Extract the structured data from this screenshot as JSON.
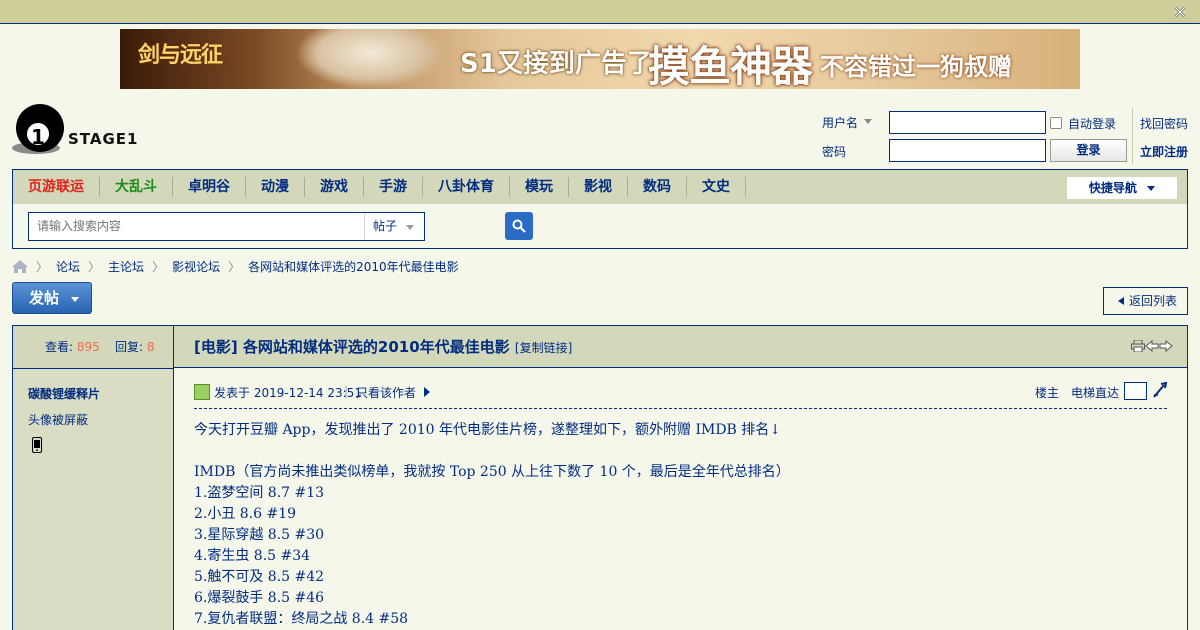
{
  "topbar": {
    "close_icon": "close-icon"
  },
  "banner": {
    "game_logo": "剑与远征",
    "ad_line_a": "S1又接到广告了",
    "ad_line_b": "摸鱼神器",
    "ad_line_c": "不容错过一狗叔赠"
  },
  "logo": {
    "number": "1",
    "text": "STAGE1"
  },
  "login": {
    "username_label": "用户名",
    "password_label": "密码",
    "auto_login": "自动登录",
    "login_button": "登录",
    "find_password": "找回密码",
    "register": "立即注册"
  },
  "nav": {
    "items": [
      {
        "label": "页游联运",
        "color": "#e0241a"
      },
      {
        "label": "大乱斗",
        "color": "#1c8c1c"
      },
      {
        "label": "卓明谷"
      },
      {
        "label": "动漫"
      },
      {
        "label": "游戏"
      },
      {
        "label": "手游"
      },
      {
        "label": "八卦体育"
      },
      {
        "label": "模玩"
      },
      {
        "label": "影视"
      },
      {
        "label": "数码"
      },
      {
        "label": "文史"
      }
    ],
    "quick_nav": "快捷导航",
    "search_placeholder": "请输入搜索内容",
    "search_type": "帖子"
  },
  "breadcrumb": [
    "论坛",
    "主论坛",
    "影视论坛",
    "各网站和媒体评选的2010年代最佳电影"
  ],
  "post_button": "发帖",
  "back_button": "返回列表",
  "thread": {
    "views_label": "查看:",
    "views": "895",
    "replies_label": "回复:",
    "replies": "8",
    "title": "[电影] 各网站和媒体评选的2010年代最佳电影",
    "copy_link": "[复制链接]",
    "author": "碳酸锂缓释片",
    "avatar_masked": "头像被屏蔽",
    "posted_at": "发表于 2019-12-14 23:51",
    "only_author": "只看该作者",
    "floor": "楼主",
    "jump_floor": "电梯直达",
    "body": [
      "今天打开豆瓣 App，发现推出了 2010 年代电影佳片榜，遂整理如下，额外附赠 IMDB 排名↓",
      "",
      "IMDB（官方尚未推出类似榜单，我就按 Top 250 从上往下数了 10 个，最后是全年代总排名）",
      "1.盗梦空间 8.7 #13",
      "2.小丑 8.6 #19",
      "3.星际穿越 8.5 #30",
      "4.寄生虫 8.5 #34",
      "5.触不可及 8.5 #42",
      "6.爆裂鼓手 8.5 #46",
      "7.复仇者联盟：终局之战 8.4 #58"
    ]
  },
  "colors": {
    "accent": "#022c80",
    "nav_bg": "#d3d8bb",
    "page_bg": "#f6f7eb",
    "highlight": "#f26c4f"
  }
}
